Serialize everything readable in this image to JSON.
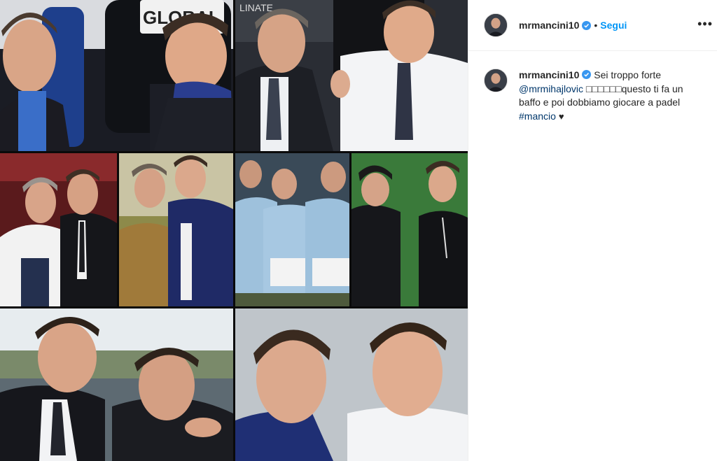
{
  "post": {
    "username": "mrmancini10",
    "follow_label": "Segui",
    "separator": "•",
    "more_label": "•••",
    "verified_icon": "verified-badge-icon",
    "colors": {
      "accent": "#0095f6",
      "link": "#00376b",
      "text": "#262626"
    }
  },
  "caption": {
    "username": "mrmancini10",
    "text_before": "Sei troppo forte ",
    "mention": "@mrmihajlovic",
    "middle": " □□□□□□questo ti fa un baffo e poi dobbiamo giocare a padel ",
    "hashtag": "#mancio",
    "heart": "♥"
  },
  "collage": {
    "photo_texts": [
      "GLOBAL",
      "LINATE"
    ]
  }
}
